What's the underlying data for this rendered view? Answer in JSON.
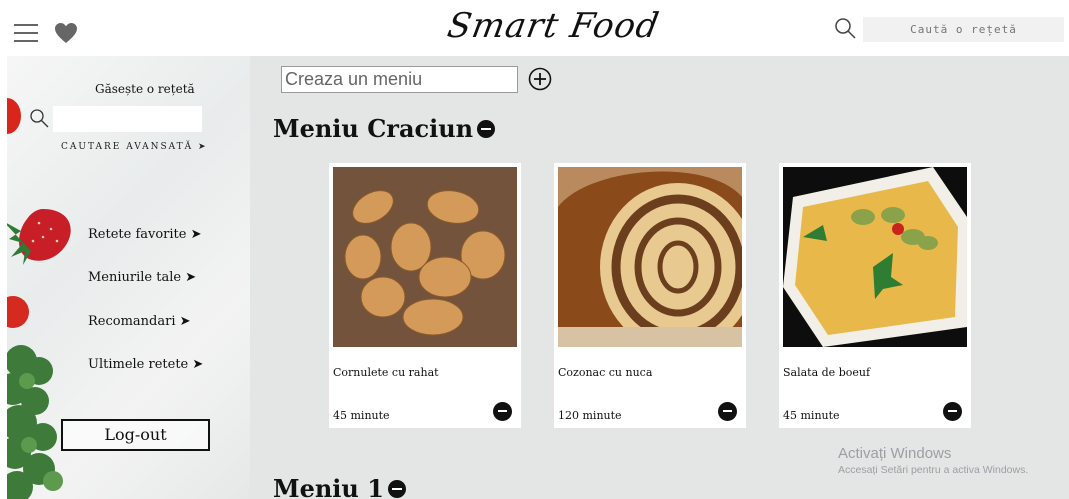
{
  "header": {
    "logo": "Smart Food",
    "search_placeholder": "Caută o rețetă",
    "icons": {
      "menu": "hamburger-menu-icon",
      "favorites": "heart-icon",
      "search": "search-icon"
    }
  },
  "sidebar": {
    "title": "Găsește o rețetă",
    "advanced_search": "CAUTARE AVANSATĂ ➤",
    "items": [
      {
        "label": "Retete favorite ➤"
      },
      {
        "label": "Meniurile tale ➤"
      },
      {
        "label": "Recomandari ➤"
      },
      {
        "label": "Ultimele retete ➤"
      }
    ],
    "logout": "Log-out"
  },
  "main": {
    "create_menu_placeholder": "Creaza un meniu",
    "menus": [
      {
        "title": "Meniu Craciun",
        "recipes": [
          {
            "name": "Cornulete cu rahat",
            "time": "45 minute"
          },
          {
            "name": "Cozonac cu nuca",
            "time": "120 minute"
          },
          {
            "name": "Salata de boeuf",
            "time": "45 minute"
          }
        ]
      },
      {
        "title": "Meniu 1"
      }
    ]
  },
  "watermark": {
    "line1": "Activați Windows",
    "line2": "Accesați Setări pentru a activa Windows."
  },
  "colors": {
    "main_bg": "#e4e6e5",
    "accent": "#111111",
    "search_bg": "#f1f1f1"
  }
}
